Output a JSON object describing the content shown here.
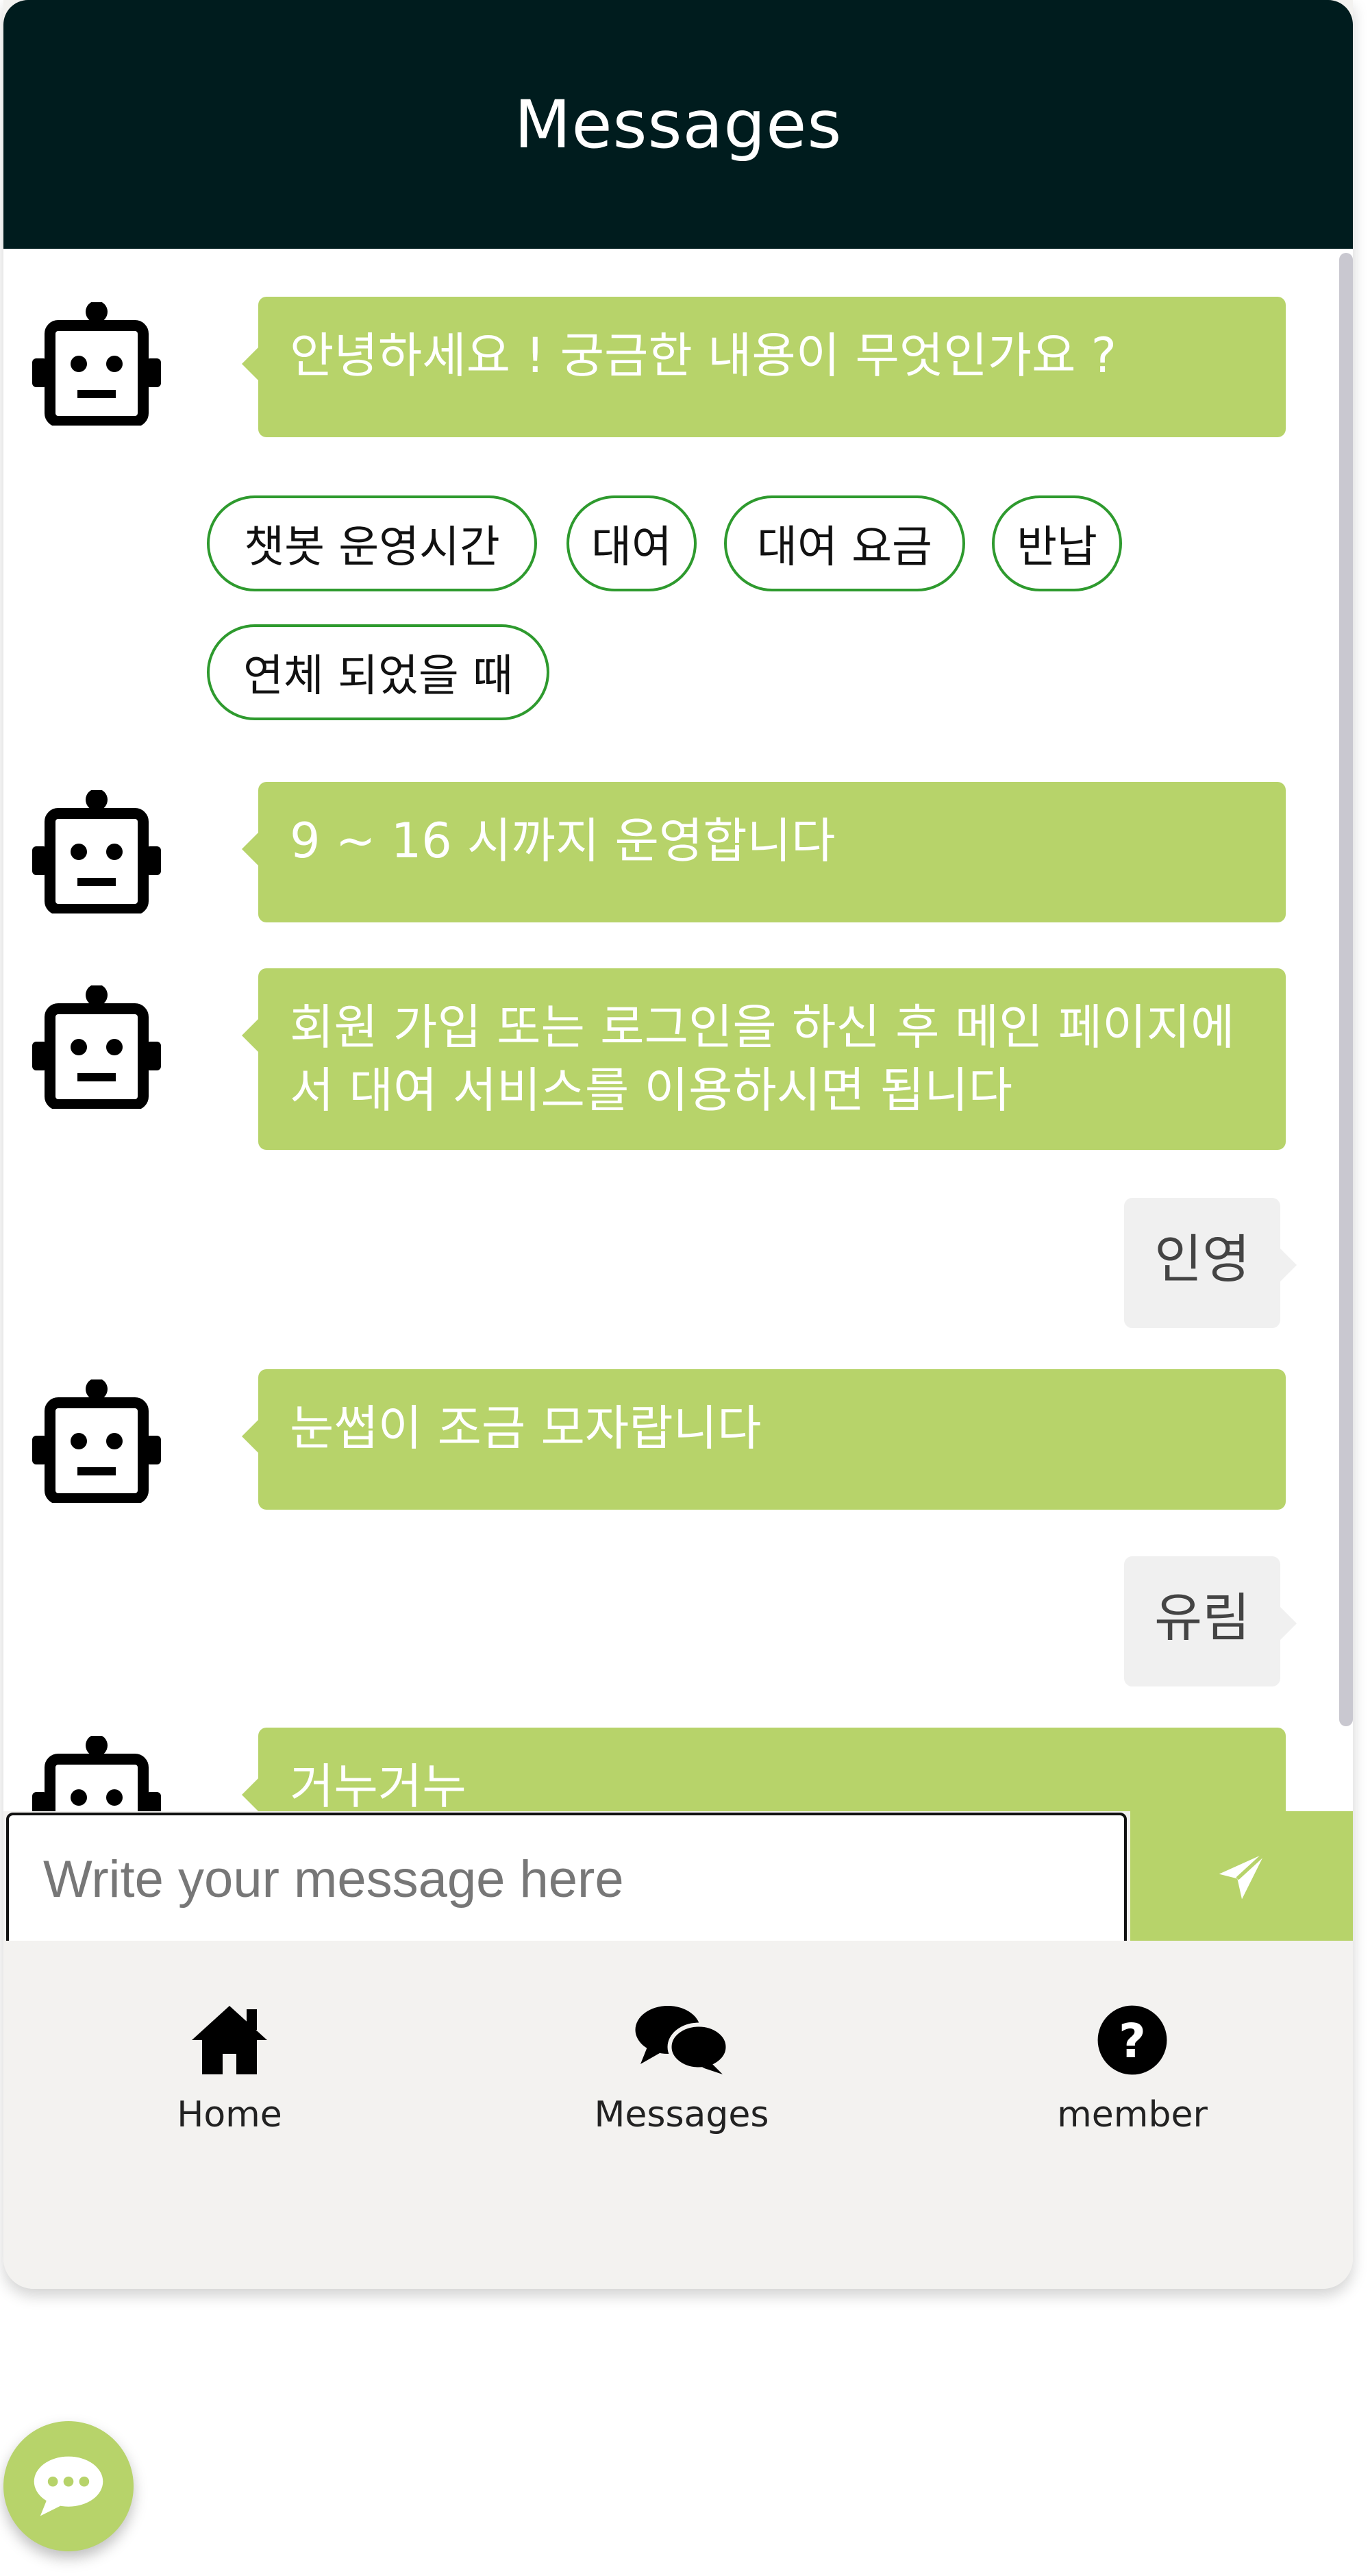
{
  "header": {
    "title": "Messages"
  },
  "chat": {
    "messages": [
      {
        "from": "bot",
        "text": "안녕하세요 ! 궁금한 내용이 무엇인가요 ?"
      },
      {
        "from": "bot",
        "text": "9 ~ 16 시까지 운영합니다"
      },
      {
        "from": "bot",
        "text": "회원 가입 또는 로그인을 하신 후 메인 페이지에서 대여 서비스를 이용하시면 됩니다"
      },
      {
        "from": "user",
        "text": "인영"
      },
      {
        "from": "bot",
        "text": "눈썹이 조금 모자랍니다"
      },
      {
        "from": "user",
        "text": "유림"
      },
      {
        "from": "bot",
        "text": "거누거누"
      }
    ],
    "quick_replies": [
      "챗봇 운영시간",
      "대여",
      "대여 요금",
      "반납",
      "연체 되었을 때"
    ]
  },
  "composer": {
    "placeholder": "Write your message here",
    "value": ""
  },
  "nav": {
    "items": [
      {
        "label": "Home",
        "icon": "home-icon"
      },
      {
        "label": "Messages",
        "icon": "chat-bubbles-icon"
      },
      {
        "label": "member",
        "icon": "question-circle-icon"
      }
    ]
  },
  "colors": {
    "header_bg": "#001c1e",
    "bot_bubble": "#b7d36a",
    "user_bubble": "#f0f0f0",
    "chip_border": "#2e9a2e",
    "nav_bg": "#f3f2f0"
  }
}
